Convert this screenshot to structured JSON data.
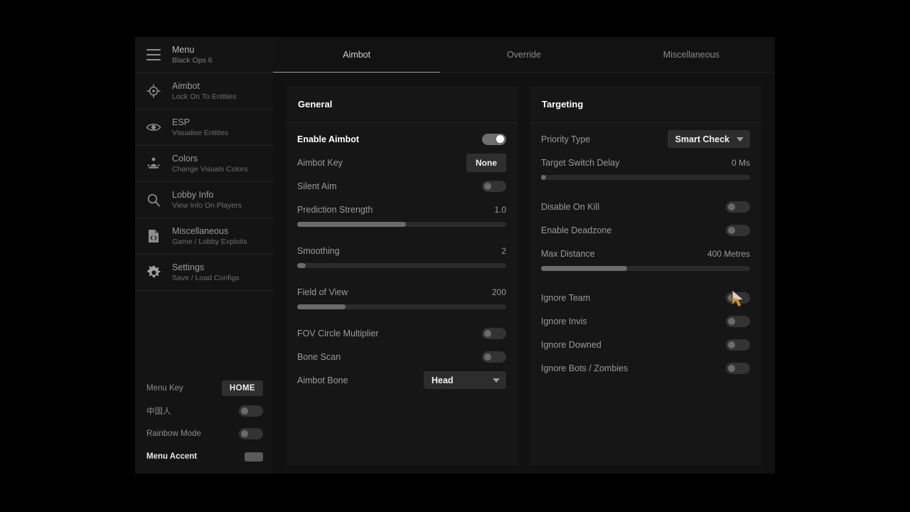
{
  "sidebar": {
    "header": {
      "icon": "hamburger-icon",
      "title": "Menu",
      "subtitle": "Black Ops 6"
    },
    "items": [
      {
        "icon": "crosshair-icon",
        "title": "Aimbot",
        "subtitle": "Lock On To Entities"
      },
      {
        "icon": "eye-icon",
        "title": "ESP",
        "subtitle": "Visualise Entities"
      },
      {
        "icon": "palette-person-icon",
        "title": "Colors",
        "subtitle": "Change Visuals Colors"
      },
      {
        "icon": "magnifier-icon",
        "title": "Lobby Info",
        "subtitle": "View Info On Players"
      },
      {
        "icon": "file-code-icon",
        "title": "Miscellaneous",
        "subtitle": "Game / Lobby Exploits"
      },
      {
        "icon": "gear-icon",
        "title": "Settings",
        "subtitle": "Save / Load Configs"
      }
    ],
    "footer": {
      "menu_key_label": "Menu Key",
      "menu_key_value": "HOME",
      "chinese_label": "中国人",
      "chinese_on": false,
      "rainbow_label": "Rainbow Mode",
      "rainbow_on": false,
      "accent_label": "Menu Accent",
      "accent_color": "#5a5a5a"
    }
  },
  "tabs": [
    {
      "label": "Aimbot",
      "active": true
    },
    {
      "label": "Override",
      "active": false
    },
    {
      "label": "Miscellaneous",
      "active": false
    }
  ],
  "general_panel": {
    "title": "General",
    "enable_aimbot": {
      "label": "Enable Aimbot",
      "on": true
    },
    "aimbot_key": {
      "label": "Aimbot Key",
      "value": "None"
    },
    "silent_aim": {
      "label": "Silent Aim",
      "on": false
    },
    "prediction_strength": {
      "label": "Prediction Strength",
      "value": "1.0",
      "percent": 52
    },
    "smoothing": {
      "label": "Smoothing",
      "value": "2",
      "percent": 4
    },
    "field_of_view": {
      "label": "Field of View",
      "value": "200",
      "percent": 23
    },
    "fov_circle_multiplier": {
      "label": "FOV Circle Multiplier",
      "on": false
    },
    "bone_scan": {
      "label": "Bone Scan",
      "on": false
    },
    "aimbot_bone": {
      "label": "Aimbot Bone",
      "value": "Head"
    }
  },
  "targeting_panel": {
    "title": "Targeting",
    "priority_type": {
      "label": "Priority Type",
      "value": "Smart Check"
    },
    "target_switch_delay": {
      "label": "Target Switch Delay",
      "value": "0 Ms",
      "percent": 2
    },
    "disable_on_kill": {
      "label": "Disable On Kill",
      "on": false
    },
    "enable_deadzone": {
      "label": "Enable Deadzone",
      "on": false
    },
    "max_distance": {
      "label": "Max Distance",
      "value": "400 Metres",
      "percent": 41
    },
    "ignore_team": {
      "label": "Ignore Team",
      "on": false
    },
    "ignore_invis": {
      "label": "Ignore Invis",
      "on": false
    },
    "ignore_downed": {
      "label": "Ignore Downed",
      "on": false
    },
    "ignore_bots_zombies": {
      "label": "Ignore Bots / Zombies",
      "on": false
    }
  },
  "cursor": {
    "icon": "arrow-pointer-cursor"
  }
}
